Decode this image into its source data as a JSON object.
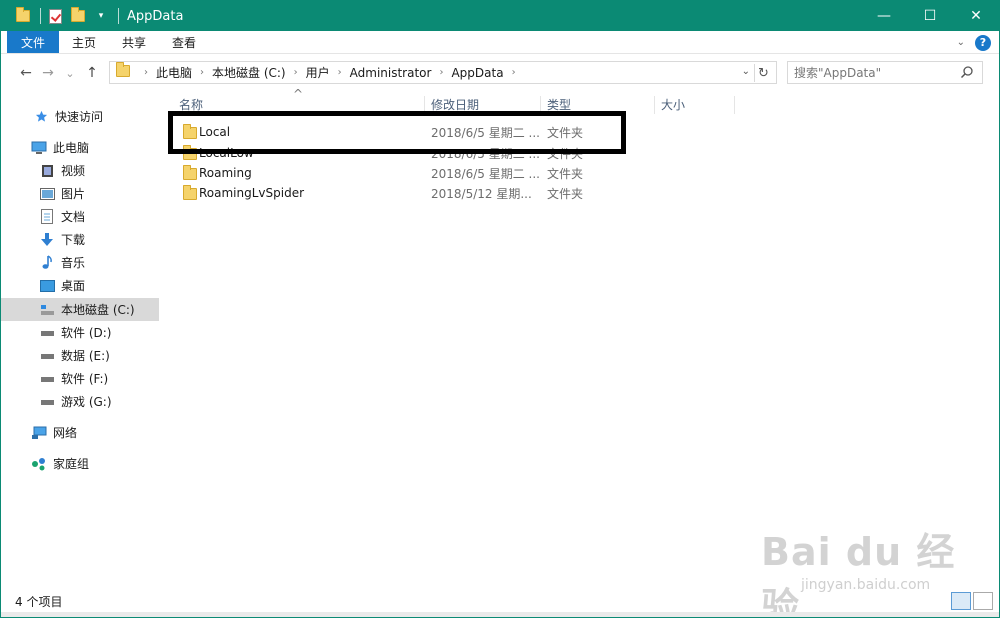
{
  "window": {
    "title": "AppData",
    "controls": {
      "minimize": "—",
      "maximize": "☐",
      "close": "✕"
    },
    "accent": "#0b8a74"
  },
  "ribbon": {
    "tabs": [
      "文件",
      "主页",
      "共享",
      "查看"
    ],
    "file_color": "#1979ca",
    "help_label": "?"
  },
  "navigation": {
    "back": "←",
    "forward": "→",
    "recent": "⌄",
    "up": "↑",
    "breadcrumbs": [
      "此电脑",
      "本地磁盘 (C:)",
      "用户",
      "Administrator",
      "AppData"
    ],
    "refresh": "↻",
    "search_placeholder": "搜索\"AppData\""
  },
  "sidebar": {
    "items": [
      {
        "label": "快速访问",
        "icon": "star-icon"
      },
      {
        "label": "此电脑",
        "icon": "computer-icon"
      },
      {
        "label": "视频",
        "icon": "video-icon"
      },
      {
        "label": "图片",
        "icon": "picture-icon"
      },
      {
        "label": "文档",
        "icon": "document-icon"
      },
      {
        "label": "下载",
        "icon": "download-icon"
      },
      {
        "label": "音乐",
        "icon": "music-icon"
      },
      {
        "label": "桌面",
        "icon": "desktop-icon"
      },
      {
        "label": "本地磁盘 (C:)",
        "icon": "system-drive-icon",
        "selected": true
      },
      {
        "label": "软件 (D:)",
        "icon": "drive-icon"
      },
      {
        "label": "数据 (E:)",
        "icon": "drive-icon"
      },
      {
        "label": "软件 (F:)",
        "icon": "drive-icon"
      },
      {
        "label": "游戏 (G:)",
        "icon": "drive-icon"
      },
      {
        "label": "网络",
        "icon": "network-icon"
      },
      {
        "label": "家庭组",
        "icon": "homegroup-icon"
      }
    ]
  },
  "file_list": {
    "columns": [
      "名称",
      "修改日期",
      "类型",
      "大小"
    ],
    "sort_indicator": "^",
    "rows": [
      {
        "name": "Local",
        "date": "2018/6/5 星期二 ...",
        "type": "文件夹"
      },
      {
        "name": "LocalLow",
        "date": "2018/6/5 星期二 ...",
        "type": "文件夹"
      },
      {
        "name": "Roaming",
        "date": "2018/6/5 星期二 ...",
        "type": "文件夹"
      },
      {
        "name": "RoamingLvSpider",
        "date": "2018/5/12 星期...",
        "type": "文件夹"
      }
    ]
  },
  "status": {
    "item_count": "4 个项目"
  },
  "watermark": {
    "logo": "Bai du 经验",
    "url": "jingyan.baidu.com"
  }
}
